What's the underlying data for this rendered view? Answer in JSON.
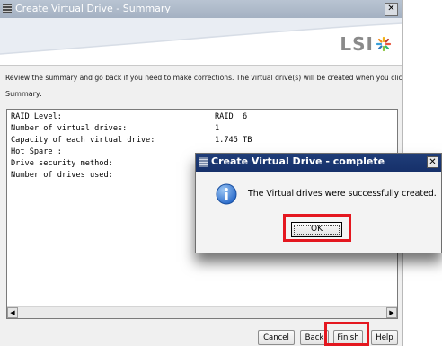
{
  "main_window": {
    "title": "Create Virtual Drive - Summary",
    "close_glyph": "✕",
    "logo_text": "LSI",
    "review_text": "Review the summary and go back if you need to make corrections. The virtual drive(s) will be created when you click finish.",
    "summary_label": "Summary:",
    "summary_rows": [
      {
        "label": "RAID Level:",
        "value": "RAID  6"
      },
      {
        "label": "Number of virtual drives:",
        "value": "1"
      },
      {
        "label": "Capacity of each virtual drive:",
        "value": "1.745 TB"
      },
      {
        "label": "Hot Spare :",
        "value": ""
      },
      {
        "label": "Drive security method:",
        "value": ""
      },
      {
        "label": "Number of drives used:",
        "value": ""
      }
    ],
    "buttons": {
      "cancel": "Cancel",
      "back": "Back",
      "finish": "Finish",
      "help": "Help"
    },
    "scroll_left_glyph": "◀",
    "scroll_right_glyph": "▶"
  },
  "dialog": {
    "title": "Create Virtual Drive - complete",
    "close_glyph": "✕",
    "message": "The Virtual drives were successfully created.",
    "ok_label": "OK"
  },
  "icons": {
    "window_icon": "drive-stack-icon",
    "info_icon": "info-icon",
    "logo_icon": "lsi-star-icon"
  },
  "colors": {
    "highlight_red": "#e4171f",
    "dialog_title_bar": "#1f3d78",
    "main_title_bar": "#a4b1c2"
  }
}
